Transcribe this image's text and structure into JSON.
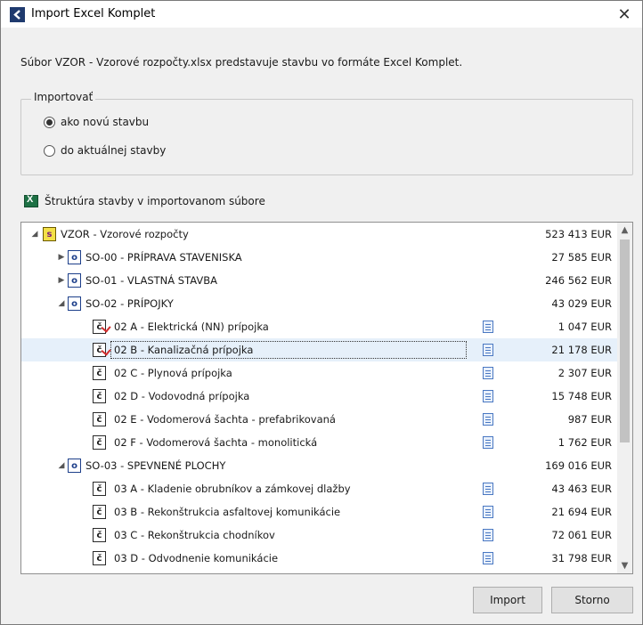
{
  "window": {
    "title": "Import Excel Komplet"
  },
  "info_text": "Súbor VZOR - Vzorové rozpočty.xlsx predstavuje stavbu vo formáte Excel Komplet.",
  "import_group": {
    "legend": "Importovať",
    "options": [
      {
        "label": "ako novú stavbu",
        "checked": true
      },
      {
        "label": "do aktuálnej stavby",
        "checked": false
      }
    ]
  },
  "structure": {
    "heading": "Štruktúra stavby v importovanom súbore",
    "rows": [
      {
        "level": 0,
        "expander": "expanded",
        "icon": "s",
        "label": "VZOR - Vzorové rozpočty",
        "amount": "523 413 EUR",
        "doc": false,
        "mark": false
      },
      {
        "level": 1,
        "expander": "collapsed",
        "icon": "o",
        "label": "SO-00 - PRÍPRAVA STAVENISKA",
        "amount": "27 585 EUR",
        "doc": false,
        "mark": false
      },
      {
        "level": 1,
        "expander": "collapsed",
        "icon": "o",
        "label": "SO-01 - VLASTNÁ STAVBA",
        "amount": "246 562 EUR",
        "doc": false,
        "mark": false
      },
      {
        "level": 1,
        "expander": "expanded",
        "icon": "o",
        "label": "SO-02 - PRÍPOJKY",
        "amount": "43 029 EUR",
        "doc": false,
        "mark": false
      },
      {
        "level": 2,
        "expander": "none",
        "icon": "č",
        "label": "02 A - Elektrická (NN) prípojka",
        "amount": "1 047 EUR",
        "doc": true,
        "mark": true
      },
      {
        "level": 2,
        "expander": "none",
        "icon": "č",
        "label": "02 B - Kanalizačná prípojka",
        "amount": "21 178 EUR",
        "doc": true,
        "mark": true,
        "selected": true
      },
      {
        "level": 2,
        "expander": "none",
        "icon": "č",
        "label": "02 C - Plynová prípojka",
        "amount": "2 307 EUR",
        "doc": true,
        "mark": false
      },
      {
        "level": 2,
        "expander": "none",
        "icon": "č",
        "label": "02 D - Vodovodná prípojka",
        "amount": "15 748 EUR",
        "doc": true,
        "mark": false
      },
      {
        "level": 2,
        "expander": "none",
        "icon": "č",
        "label": "02 E - Vodomerová šachta - prefabrikovaná",
        "amount": "987 EUR",
        "doc": true,
        "mark": false
      },
      {
        "level": 2,
        "expander": "none",
        "icon": "č",
        "label": "02 F - Vodomerová šachta - monolitická",
        "amount": "1 762 EUR",
        "doc": true,
        "mark": false
      },
      {
        "level": 1,
        "expander": "expanded",
        "icon": "o",
        "label": "SO-03 - SPEVNENÉ PLOCHY",
        "amount": "169 016 EUR",
        "doc": false,
        "mark": false
      },
      {
        "level": 2,
        "expander": "none",
        "icon": "č",
        "label": "03 A - Kladenie obrubníkov a zámkovej dlažby",
        "amount": "43 463 EUR",
        "doc": true,
        "mark": false
      },
      {
        "level": 2,
        "expander": "none",
        "icon": "č",
        "label": "03 B - Rekonštrukcia asfaltovej komunikácie",
        "amount": "21 694 EUR",
        "doc": true,
        "mark": false
      },
      {
        "level": 2,
        "expander": "none",
        "icon": "č",
        "label": "03 C - Rekonštrukcia chodníkov",
        "amount": "72 061 EUR",
        "doc": true,
        "mark": false
      },
      {
        "level": 2,
        "expander": "none",
        "icon": "č",
        "label": "03 D - Odvodnenie komunikácie",
        "amount": "31 798 EUR",
        "doc": true,
        "mark": false
      }
    ]
  },
  "buttons": {
    "import": "Import",
    "cancel": "Storno"
  },
  "icons": {
    "app": "back-arrow-icon",
    "close": "close-icon",
    "excel": "excel-icon",
    "document": "document-icon",
    "scroll_up": "scroll-up-icon",
    "scroll_down": "scroll-down-icon"
  }
}
